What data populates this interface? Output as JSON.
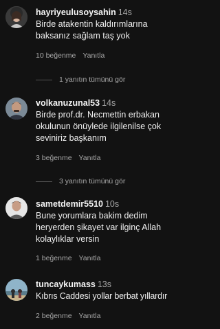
{
  "comments": [
    {
      "username": "hayriyeulusoysahin",
      "time": "14s",
      "text": "Birde atakentin kaldırımlarına\nbaksanız sağlam taş yok",
      "likes": "10 beğenme",
      "reply_label": "Yanıtla"
    },
    {
      "username": "volkanuzunal53",
      "time": "14s",
      "text": "Birde prof.dr. Necmettin erbakan\nokulunun önüylede ilgilenilse çok\nseviniriz başkanım",
      "likes": "3 beğenme",
      "reply_label": "Yanıtla"
    },
    {
      "username": "sametdemir5510",
      "time": "10s",
      "text": "Bune yorumlara bakim dedim\nheryerden şikayet var ilginç Allah\nkolaylıklar versin",
      "likes": "1 beğenme",
      "reply_label": "Yanıtla"
    },
    {
      "username": "tuncaykumass",
      "time": "13s",
      "text": "Kıbrıs Caddesi yollar berbat yıllardır",
      "likes": "2 beğenme",
      "reply_label": "Yanıtla"
    }
  ],
  "view_replies": [
    {
      "label": "1 yanıtın tümünü gör"
    },
    {
      "label": "3 yanıtın tümünü gör"
    }
  ],
  "colors": {
    "background": "#121212",
    "text_primary": "#f5f5f5",
    "text_secondary": "#a8a8a8"
  }
}
